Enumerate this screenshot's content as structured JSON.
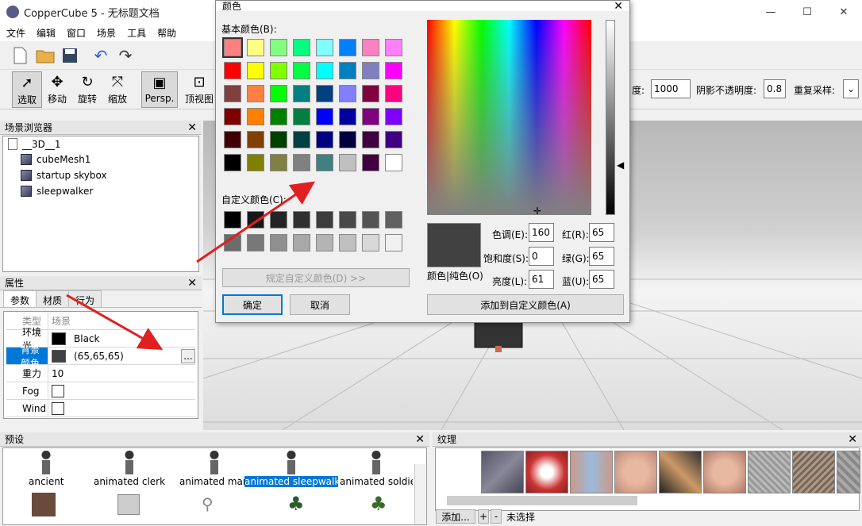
{
  "app": {
    "title": "CopperCube 5 - 无标题文档",
    "minimize": "—",
    "maximize": "☐",
    "close": "✕"
  },
  "menu": [
    "文件",
    "编辑",
    "窗口",
    "场景",
    "工具",
    "帮助"
  ],
  "tools": {
    "select": "选取",
    "move": "移动",
    "rotate": "旋转",
    "scale": "缩放",
    "persp": "Persp.",
    "top": "顶视图"
  },
  "toolbar_right": {
    "label1": "度:",
    "value1": "1000",
    "label2": "阴影不透明度:",
    "value2": "0.8",
    "label3": "重复采样:"
  },
  "scene_browser": {
    "title": "场景浏览器",
    "items": [
      "__3D__1",
      "cubeMesh1",
      "startup skybox",
      "sleepwalker"
    ]
  },
  "properties": {
    "title": "属性",
    "tabs": [
      "参数",
      "材质",
      "行为"
    ],
    "rows": [
      {
        "k": "类型",
        "v": "场景"
      },
      {
        "k": "环境光",
        "v": "Black"
      },
      {
        "k": "背景颜色",
        "v": "(65,65,65)"
      },
      {
        "k": "重力",
        "v": "10"
      },
      {
        "k": "Fog",
        "v": ""
      },
      {
        "k": "Wind",
        "v": ""
      }
    ],
    "ellipsis": "..."
  },
  "dialog": {
    "title": "颜色",
    "close": "✕",
    "basic_label": "基本颜色(B):",
    "custom_label": "自定义颜色(C):",
    "define_btn": "规定自定义颜色(D) >>",
    "ok": "确定",
    "cancel": "取消",
    "hue_label": "色调(E):",
    "hue": "160",
    "sat_label": "饱和度(S):",
    "sat": "0",
    "lum_label": "亮度(L):",
    "lum": "61",
    "red_label": "红(R):",
    "red": "65",
    "green_label": "绿(G):",
    "green": "65",
    "blue_label": "蓝(U):",
    "blue": "65",
    "solid_label": "颜色|纯色(O)",
    "add_btn": "添加到自定义颜色(A)",
    "basic_colors": [
      "#ff8080",
      "#ffff80",
      "#80ff80",
      "#00ff80",
      "#80ffff",
      "#0080ff",
      "#ff80c0",
      "#ff80ff",
      "#ff0000",
      "#ffff00",
      "#80ff00",
      "#00ff40",
      "#00ffff",
      "#0080c0",
      "#8080c0",
      "#ff00ff",
      "#804040",
      "#ff8040",
      "#00ff00",
      "#008080",
      "#004080",
      "#8080ff",
      "#800040",
      "#ff0080",
      "#800000",
      "#ff8000",
      "#008000",
      "#008040",
      "#0000ff",
      "#0000a0",
      "#800080",
      "#8000ff",
      "#400000",
      "#804000",
      "#004000",
      "#004040",
      "#000080",
      "#000040",
      "#400040",
      "#400080",
      "#000000",
      "#808000",
      "#808040",
      "#808080",
      "#408080",
      "#c0c0c0",
      "#400040",
      "#ffffff"
    ],
    "custom_colors": [
      "#000000",
      "#181818",
      "#242424",
      "#303030",
      "#3c3c3c",
      "#484848",
      "#545454",
      "#606060",
      "#6c6c6c",
      "#787878",
      "#909090",
      "#a8a8a8",
      "#b4b4b4",
      "#c0c0c0",
      "#d8d8d8",
      "#f0f0f0"
    ],
    "current_color": "#414141"
  },
  "presets": {
    "title": "预设",
    "items": [
      "ancient",
      "animated clerk",
      "animated man",
      "animated sleepwalk",
      "animated soldie"
    ]
  },
  "textures": {
    "title": "纹理",
    "add": "添加...",
    "plus": "+",
    "minus": "-",
    "status": "未选择"
  },
  "colors": {
    "selection": "#0078d7",
    "arrow": "#e02020"
  }
}
